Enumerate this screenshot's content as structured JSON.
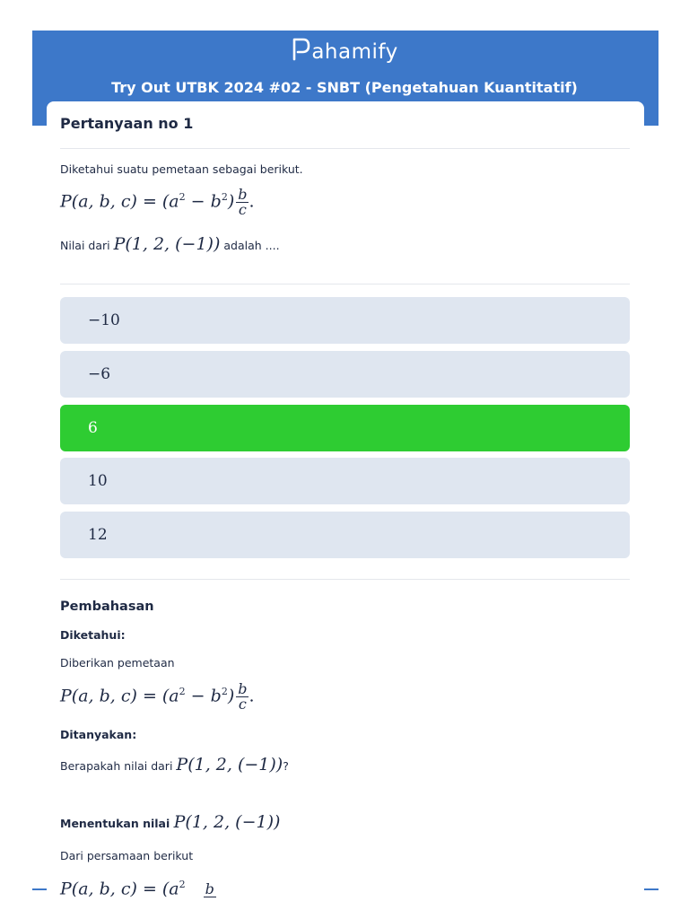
{
  "header": {
    "logo_text": "ahamify",
    "exam_title": "Try Out UTBK 2024 #02 - SNBT (Pengetahuan Kuantitatif)",
    "brand_color": "#3d78c9"
  },
  "question": {
    "title": "Pertanyaan no 1",
    "intro": "Diketahui suatu pemetaan sebagai berikut.",
    "formula_lhs": "P(a, b, c) = (a",
    "formula_mid": " − b",
    "formula_end": ")",
    "formula_exp": "2",
    "formula_num": "b",
    "formula_den": "c",
    "formula_dot": ".",
    "ask_prefix": "Nilai dari",
    "ask_math": "P(1, 2, (−1))",
    "ask_suffix": "adalah ...."
  },
  "options": [
    {
      "label": "−10",
      "selected": false
    },
    {
      "label": "−6",
      "selected": false
    },
    {
      "label": "6",
      "selected": true
    },
    {
      "label": "10",
      "selected": false
    },
    {
      "label": "12",
      "selected": false
    }
  ],
  "colors": {
    "option_bg": "#dfe6f0",
    "selected_bg": "#2ecc32"
  },
  "discussion": {
    "title": "Pembahasan",
    "known_label": "Diketahui:",
    "known_text": "Diberikan pemetaan",
    "asked_label": "Ditanyakan:",
    "asked_prefix": "Berapakah nilai dari",
    "asked_math": "P(1, 2, (−1))",
    "asked_suffix": "?",
    "determine_prefix": "Menentukan nilai",
    "determine_math": "P(1, 2, (−1))",
    "from_equation": "Dari persamaan berikut",
    "partial_formula": "P(a, b, c) = (a",
    "partial_num": "b"
  }
}
